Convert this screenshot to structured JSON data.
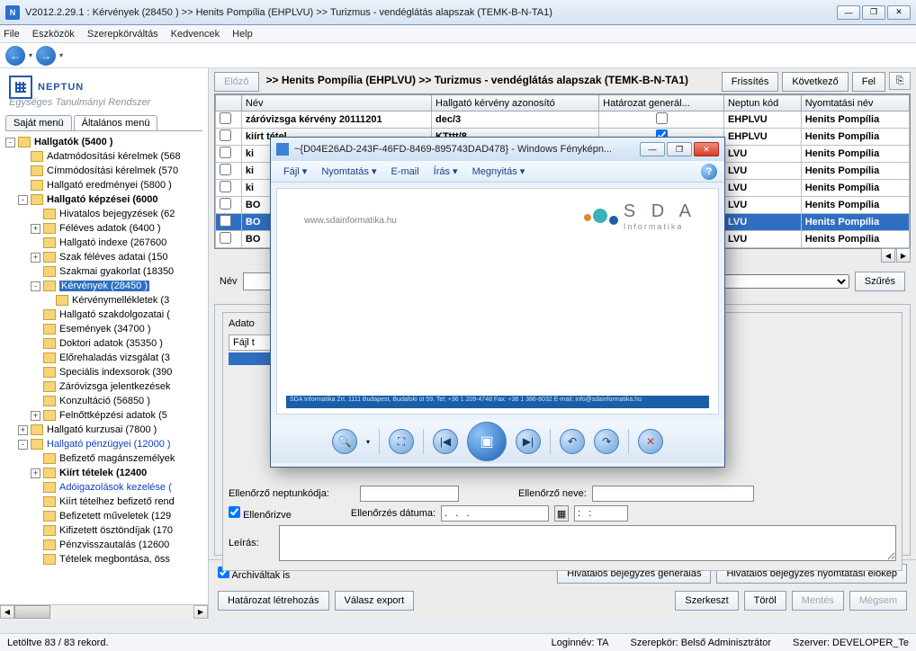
{
  "window": {
    "title": "V2012.2.29.1 : Kérvények (28450  )  >> Henits Pompília (EHPLVU) >> Turizmus - vendéglátás alapszak (TEMK-B-N-TA1)"
  },
  "menubar": [
    "File",
    "Eszközök",
    "Szerepkörváltás",
    "Kedvencek",
    "Help"
  ],
  "logo": {
    "brand": "NEPTUN",
    "tagline": "Egységes Tanulmányi Rendszer"
  },
  "left_tabs": {
    "a": "Saját menü",
    "b": "Általános menü"
  },
  "tree": [
    {
      "l": 0,
      "exp": "-",
      "bold": true,
      "label": "Hallgatók (5400  )"
    },
    {
      "l": 1,
      "exp": " ",
      "label": "Adatmódosítási kérelmek (568"
    },
    {
      "l": 1,
      "exp": " ",
      "label": "Címmódosítási kérelmek (570"
    },
    {
      "l": 1,
      "exp": " ",
      "label": "Hallgató eredményei (5800  )"
    },
    {
      "l": 1,
      "exp": "-",
      "bold": true,
      "label": "Hallgató képzései (6000"
    },
    {
      "l": 2,
      "exp": " ",
      "label": "Hivatalos bejegyzések (62"
    },
    {
      "l": 2,
      "exp": "+",
      "label": "Féléves adatok (6400  )"
    },
    {
      "l": 2,
      "exp": " ",
      "label": "Hallgató indexe (267600"
    },
    {
      "l": 2,
      "exp": "+",
      "label": "Szak féléves adatai (150"
    },
    {
      "l": 2,
      "exp": " ",
      "label": "Szakmai gyakorlat (18350"
    },
    {
      "l": 2,
      "exp": "-",
      "sel": true,
      "label": "Kérvények  (28450  )"
    },
    {
      "l": 3,
      "exp": " ",
      "label": "Kérvénymellékletek (3"
    },
    {
      "l": 2,
      "exp": " ",
      "label": "Hallgató szakdolgozatai ("
    },
    {
      "l": 2,
      "exp": " ",
      "label": "Események (34700  )"
    },
    {
      "l": 2,
      "exp": " ",
      "label": "Doktori adatok (35350  )"
    },
    {
      "l": 2,
      "exp": " ",
      "label": "Előrehaladás vizsgálat (3"
    },
    {
      "l": 2,
      "exp": " ",
      "label": "Speciális indexsorok (390"
    },
    {
      "l": 2,
      "exp": " ",
      "label": "Záróvizsga jelentkezések"
    },
    {
      "l": 2,
      "exp": " ",
      "label": "Konzultáció (56850  )"
    },
    {
      "l": 2,
      "exp": "+",
      "label": "Felnőttképzési adatok (5"
    },
    {
      "l": 1,
      "exp": "+",
      "label": "Hallgató kurzusai (7800  )"
    },
    {
      "l": 1,
      "exp": "-",
      "blue": true,
      "label": "Hallgató pénzügyei (12000  )"
    },
    {
      "l": 2,
      "exp": " ",
      "label": "Befizető magánszemélyek"
    },
    {
      "l": 2,
      "exp": "+",
      "bold": true,
      "label": "Kiírt tételek  (12400  "
    },
    {
      "l": 2,
      "exp": " ",
      "blue": true,
      "label": "Adóigazolások kezelése ("
    },
    {
      "l": 2,
      "exp": " ",
      "label": "Kiírt tételhez befizető rend"
    },
    {
      "l": 2,
      "exp": " ",
      "label": "Befizetett műveletek (129"
    },
    {
      "l": 2,
      "exp": " ",
      "label": "Kifizetett ösztöndíjak (170"
    },
    {
      "l": 2,
      "exp": " ",
      "label": "Pénzvisszautalás (12600"
    },
    {
      "l": 2,
      "exp": " ",
      "label": "Tételek megbontása, öss"
    }
  ],
  "toprow": {
    "prev": "Előző",
    "crumb": ">> Henits Pompília (EHPLVU) >> Turizmus - vendéglátás alapszak (TEMK-B-N-TA1)",
    "refresh": "Frissítés",
    "next": "Következő",
    "up": "Fel"
  },
  "grid": {
    "cols": [
      "",
      "Név",
      "Hallgató kérvény azonosító",
      "Határozat generál...",
      "Neptun kód",
      "Nyomtatási név"
    ],
    "rows": [
      {
        "c": false,
        "nev": "záróvizsga kérvény 20111201",
        "az": "dec/3",
        "hg": false,
        "kod": "EHPLVU",
        "ny": "Henits Pompília"
      },
      {
        "c": false,
        "nev": "kiírt tétel",
        "az": "KTttt/8",
        "hg": true,
        "kod": "EHPLVU",
        "ny": "Henits Pompília"
      },
      {
        "c": false,
        "nev": "ki",
        "az": "",
        "hg": false,
        "kod": "LVU",
        "ny": "Henits Pompília"
      },
      {
        "c": false,
        "nev": "ki",
        "az": "",
        "hg": false,
        "kod": "LVU",
        "ny": "Henits Pompília"
      },
      {
        "c": false,
        "nev": "ki",
        "az": "",
        "hg": false,
        "kod": "LVU",
        "ny": "Henits Pompília"
      },
      {
        "c": false,
        "nev": "BO",
        "az": "",
        "hg": false,
        "kod": "LVU",
        "ny": "Henits Pompília"
      },
      {
        "c": false,
        "nev": "BO",
        "az": "",
        "hg": false,
        "kod": "LVU",
        "ny": "Henits Pompília",
        "sel": true
      },
      {
        "c": false,
        "nev": "BO",
        "az": "",
        "hg": false,
        "kod": "LVU",
        "ny": "Henits Pompília"
      }
    ]
  },
  "filter": {
    "label": "Név",
    "btn": "Szűrés"
  },
  "detail": {
    "legend_adatok": "Adato",
    "fajl_tab": "Fájl t",
    "ell_kod": "Ellenőrző neptunkódja:",
    "ell_nev": "Ellenőrző neve:",
    "ellenorizve": "Ellenőrizve",
    "ell_datum": "Ellenőrzés dátuma:",
    "datum_val": ".   .   .",
    "time_val": ":   :",
    "leiras": "Leírás:"
  },
  "bottom": {
    "archivaltak": "Archiváltak is",
    "hivgen": "Hivatalos bejegyzés generálás",
    "hivny": "Hivatalos bejegyzés nyomtatási előkép",
    "hatlet": "Határozat létrehozás",
    "valexp": "Válasz export",
    "szerk": "Szerkeszt",
    "torol": "Töröl",
    "mentes": "Mentés",
    "megsem": "Mégsem"
  },
  "status": {
    "left": "Letöltve 83 / 83 rekord.",
    "login": "Loginnév: TA",
    "role": "Szerepkör: Belső Adminisztrátor",
    "server": "Szerver: DEVELOPER_Te"
  },
  "viewer": {
    "title": "~{D04E26AD-243F-46FD-8469-895743DAD478} - Windows Fényképn...",
    "menu": [
      "Fájl",
      "Nyomtatás",
      "E-mail",
      "Írás",
      "Megnyitás"
    ],
    "sdaurl": "www.sdainformatika.hu",
    "sdatxt": "S D A",
    "sdasub": "Informatika",
    "footer": "SDA Informatika Zrt.   1111 Budapest, Budafoki út 59.   Tel: +36 1 209-4748   Fax: +36 1 386-8032   E-mail: info@sdainformatika.hu"
  }
}
